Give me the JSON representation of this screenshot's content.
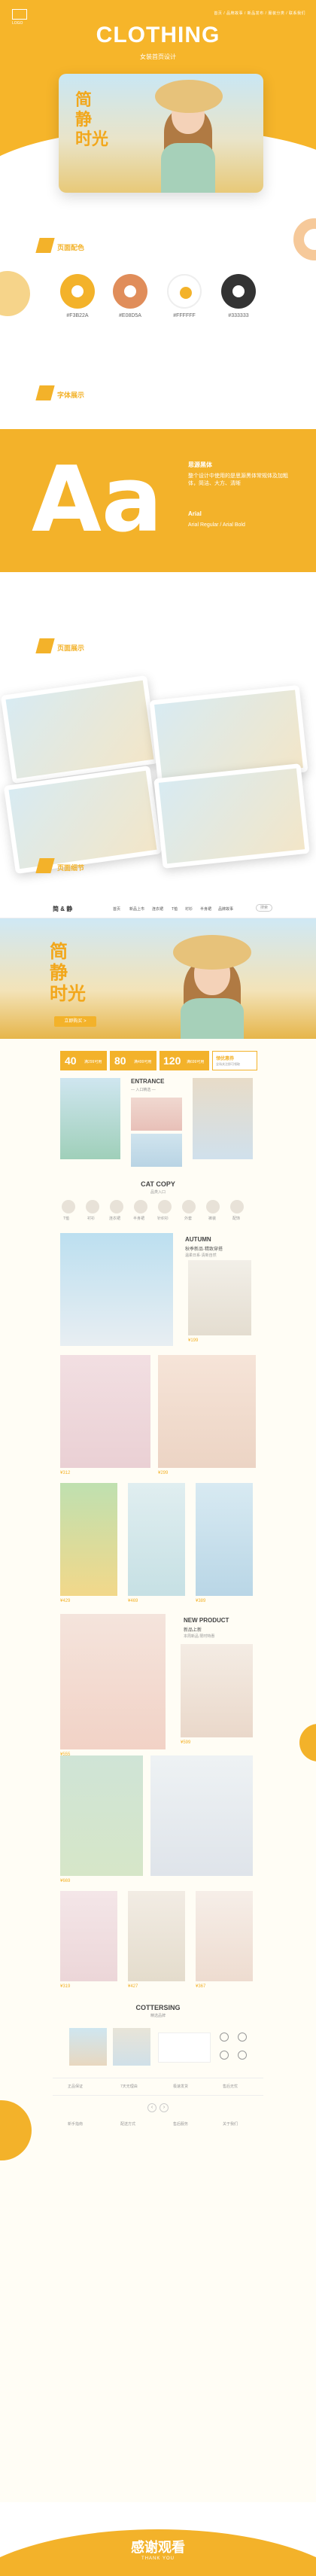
{
  "hero": {
    "logo_text": "LOGO",
    "nav": "首页 / 品牌故事 / 新品发布 / 服装分类 / 联系我们",
    "title": "CLOTHING",
    "subtitle": "女装首页设计"
  },
  "hero_card": {
    "calligraphy": [
      "简",
      "静",
      "时光"
    ]
  },
  "colors": {
    "label": "页面配色",
    "swatches": [
      {
        "hex": "#F3B22A",
        "value": "#F3B22A"
      },
      {
        "hex": "#E08D5A",
        "value": "#E08D5A"
      },
      {
        "hex": "#FFFFFF",
        "value": "#FFFFFF"
      },
      {
        "hex": "#333333",
        "value": "#333333"
      }
    ]
  },
  "fonts": {
    "label": "字体展示",
    "sample": "Aa",
    "cn_font": "思源黑体",
    "cn_desc": "整个设计中使用的是思源黑体常规体及加粗体，简洁、大方、清晰",
    "en_font": "Arial",
    "en_desc": "Arial Regular / Arial Bold"
  },
  "preview": {
    "label": "页面展示"
  },
  "detail": {
    "label": "页面细节"
  },
  "web": {
    "logo": "简 & 静",
    "nav": [
      "首页",
      "新品上市",
      "连衣裙",
      "T恤",
      "衬衫",
      "半身裙",
      "品牌故事"
    ],
    "search": "搜索",
    "banner_calli": [
      "简",
      "静",
      "时光"
    ],
    "banner_btn": "立即购买 >",
    "coupons": [
      {
        "num": "40",
        "text": "满299可用"
      },
      {
        "num": "80",
        "text": "满499可用"
      },
      {
        "num": "120",
        "text": "满699可用"
      },
      {
        "num": "领优惠券",
        "text": "全场关注即可领取"
      }
    ],
    "entrance_title": "ENTRANCE",
    "entrance_sub": "— 入口精选 —",
    "cat_title": "CAT COPY",
    "cat_sub": "品类入口",
    "categories": [
      "T恤",
      "衬衫",
      "连衣裙",
      "半身裙",
      "针织衫",
      "外套",
      "裤装",
      "配饰"
    ],
    "autumn_title": "AUTUMN",
    "autumn_sub": "秋季新品·精致穿搭",
    "autumn_desc": "温柔日系·清新自然",
    "new_title": "NEW PRODUCT",
    "new_sub": "新品上新",
    "new_desc": "本周新品 限时特惠",
    "prices": [
      "199",
      "312",
      "299",
      "429",
      "469",
      "389",
      "555",
      "599",
      "669",
      "319",
      "427",
      "367"
    ],
    "price_prefix": "¥",
    "footer_title": "COTTERSING",
    "footer_sub": "精选品牌",
    "footer_items": [
      "正品保证",
      "7天无理由",
      "极速发货",
      "售后无忧"
    ],
    "service_items": [
      "新手指南",
      "配送方式",
      "售后服务",
      "关于我们"
    ],
    "page_prev": "‹",
    "page_next": "›"
  },
  "ending": {
    "title": "感谢观看",
    "subtitle": "THANK YOU"
  }
}
